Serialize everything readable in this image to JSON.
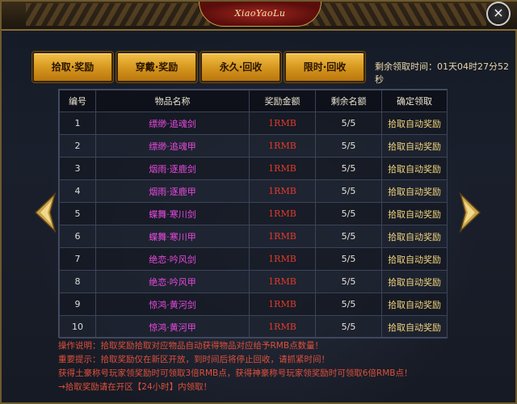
{
  "window": {
    "logo_text": "XiaoYaoLu",
    "close_label": "×"
  },
  "tabs": [
    {
      "label": "拾取·奖励"
    },
    {
      "label": "穿戴·奖励"
    },
    {
      "label": "永久·回收"
    },
    {
      "label": "限时·回收"
    }
  ],
  "countdown": "剩余领取时间：01天04时27分52秒",
  "table": {
    "headers": [
      "编号",
      "物品名称",
      "奖励金额",
      "剩余名额",
      "确定领取"
    ],
    "rows": [
      {
        "id": "1",
        "name": "缥缈·追魂剑",
        "amount": "1RMB",
        "remaining": "5/5",
        "action": "拾取自动奖励"
      },
      {
        "id": "2",
        "name": "缥缈·追魂甲",
        "amount": "1RMB",
        "remaining": "5/5",
        "action": "拾取自动奖励"
      },
      {
        "id": "3",
        "name": "烟雨·逐鹿剑",
        "amount": "1RMB",
        "remaining": "5/5",
        "action": "拾取自动奖励"
      },
      {
        "id": "4",
        "name": "烟雨·逐鹿甲",
        "amount": "1RMB",
        "remaining": "5/5",
        "action": "拾取自动奖励"
      },
      {
        "id": "5",
        "name": "蝶舞·寒川剑",
        "amount": "1RMB",
        "remaining": "5/5",
        "action": "拾取自动奖励"
      },
      {
        "id": "6",
        "name": "蝶舞·寒川甲",
        "amount": "1RMB",
        "remaining": "5/5",
        "action": "拾取自动奖励"
      },
      {
        "id": "7",
        "name": "绝恋·吟风剑",
        "amount": "1RMB",
        "remaining": "5/5",
        "action": "拾取自动奖励"
      },
      {
        "id": "8",
        "name": "绝恋·吟风甲",
        "amount": "1RMB",
        "remaining": "5/5",
        "action": "拾取自动奖励"
      },
      {
        "id": "9",
        "name": "惊鸿·黄河剑",
        "amount": "1RMB",
        "remaining": "5/5",
        "action": "拾取自动奖励"
      },
      {
        "id": "10",
        "name": "惊鸿·黄河甲",
        "amount": "1RMB",
        "remaining": "5/5",
        "action": "拾取自动奖励"
      }
    ]
  },
  "notes": [
    "操作说明：拾取奖励拾取对应物品自动获得物品对应给予RMB点数量！",
    "重要提示：拾取奖励仅在新区开放，到时间后将停止回收，请抓紧时间！",
    "获得土豪称号玩家领奖励时可领取3倍RMB点，获得神豪称号玩家领奖励时可领取6倍RMB点！",
    "→拾取奖励请在开区【24小时】内领取！"
  ],
  "colors": {
    "tab_gold": "#d4951c",
    "item_name": "#e84ae0",
    "amount_red": "#e23a2a",
    "action_gold": "#f3d57d",
    "notes_red": "#e0503a"
  },
  "icons": {
    "prev": "arrow-left-icon",
    "next": "arrow-right-icon",
    "close": "close-icon"
  }
}
